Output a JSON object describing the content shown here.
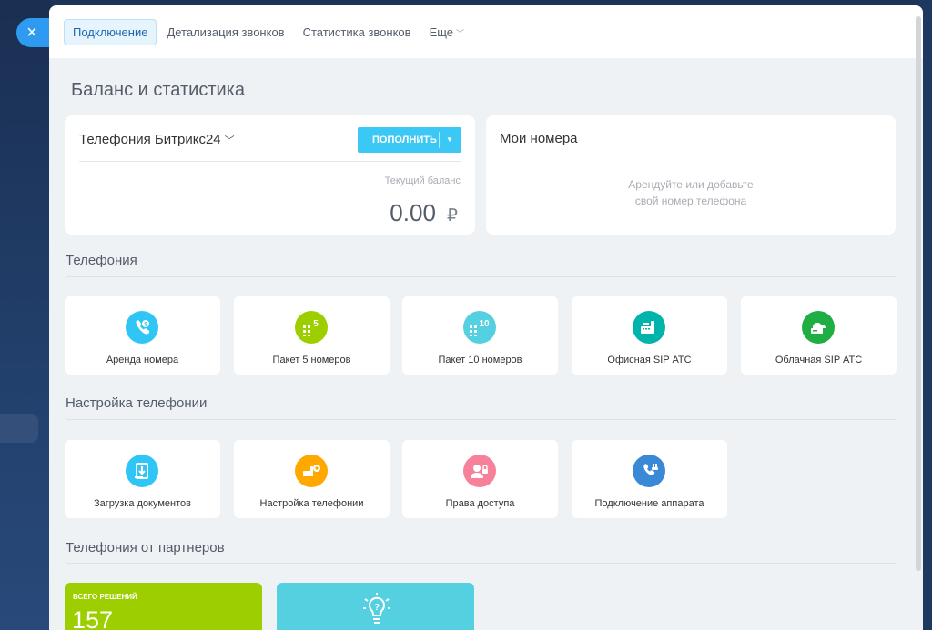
{
  "tabs": [
    {
      "label": "Подключение"
    },
    {
      "label": "Детализация звонков"
    },
    {
      "label": "Статистика звонков"
    },
    {
      "label": "Еще"
    }
  ],
  "close_icon": "×",
  "page_title": "Баланс и статистика",
  "balance": {
    "provider": "Телефония Битрикс24",
    "topup_label": "пополнить",
    "current_label": "Текущий баланс",
    "amount": "0.00",
    "currency": "₽"
  },
  "my_numbers": {
    "title": "Мои номера",
    "empty_line1": "Арендуйте или добавьте",
    "empty_line2": "свой номер телефона"
  },
  "sections": {
    "telephony": "Телефония",
    "settings": "Настройка телефонии",
    "partners": "Телефония от партнеров"
  },
  "telephony_tiles": [
    {
      "label": "Аренда номера",
      "color": "#2fc6f6",
      "icon": "phone-rent-icon"
    },
    {
      "label": "Пакет 5 номеров",
      "color": "#9dcf00",
      "icon": "package-5-icon",
      "badge": "5"
    },
    {
      "label": "Пакет 10 номеров",
      "color": "#55d0e0",
      "icon": "package-10-icon",
      "badge": "10"
    },
    {
      "label": "Офисная SIP АТС",
      "color": "#00b4ac",
      "icon": "office-sip-icon"
    },
    {
      "label": "Облачная SIP АТС",
      "color": "#1eae43",
      "icon": "cloud-sip-icon"
    }
  ],
  "settings_tiles": [
    {
      "label": "Загрузка документов",
      "color": "#2fc6f6",
      "icon": "document-upload-icon"
    },
    {
      "label": "Настройка телефонии",
      "color": "#ffa900",
      "icon": "telephony-settings-icon"
    },
    {
      "label": "Права доступа",
      "color": "#f7819a",
      "icon": "access-rights-icon"
    },
    {
      "label": "Подключение аппарата",
      "color": "#3a89d6",
      "icon": "device-connect-icon"
    }
  ],
  "partners": {
    "total_label": "всего решений",
    "total_value": "157"
  }
}
